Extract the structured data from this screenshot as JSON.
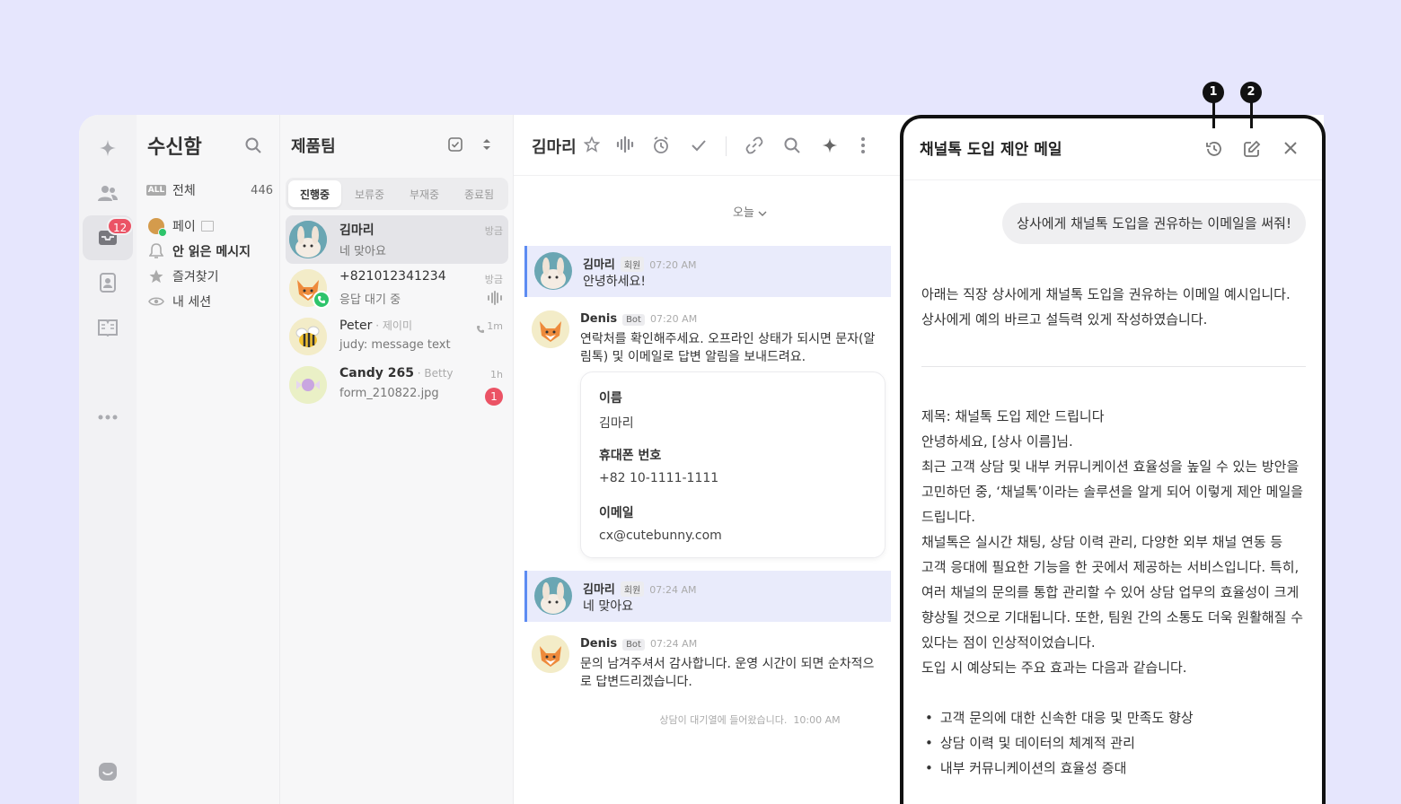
{
  "inbox": {
    "title": "수신함",
    "items": [
      {
        "label": "전체",
        "count": "446",
        "badge": "ALL"
      },
      {
        "label": "페이"
      },
      {
        "label": "안 읽은 메시지"
      },
      {
        "label": "즐겨찾기"
      },
      {
        "label": "내 세션"
      }
    ]
  },
  "rail": {
    "badge": "12",
    "ai_label": "AI"
  },
  "list": {
    "title": "제품팀",
    "tabs": [
      "진행중",
      "보류중",
      "부재중",
      "종료됨"
    ],
    "chats": [
      {
        "name": "김마리",
        "sub": "",
        "message": "네 맞아요",
        "time": "방금"
      },
      {
        "name": "+821012341234",
        "sub": "",
        "message": "응답 대기 중",
        "time": "방금"
      },
      {
        "name": "Peter",
        "sub": " · 제이미",
        "message": "judy: message text",
        "time": "1m"
      },
      {
        "name": "Candy 265",
        "sub": " · Betty",
        "message": "form_210822.jpg",
        "time": "1h",
        "unread": "1"
      }
    ]
  },
  "chat": {
    "name": "김마리",
    "date": "오늘",
    "messages": [
      {
        "name": "김마리",
        "tag": "회원",
        "time": "07:20 AM",
        "text": "안녕하세요!"
      },
      {
        "name": "Denis",
        "tag": "Bot",
        "time": "07:20 AM",
        "text": "연락처를 확인해주세요. 오프라인 상태가 되시면 문자(알림톡) 및 이메일로 답변 알림을 보내드려요."
      },
      {
        "name": "김마리",
        "tag": "회원",
        "time": "07:24 AM",
        "text": "네 맞아요"
      },
      {
        "name": "Denis",
        "tag": "Bot",
        "time": "07:24 AM",
        "text": "문의 남겨주셔서 감사합니다. 운영 시간이 되면 순차적으로 답변드리겠습니다."
      }
    ],
    "form": [
      {
        "label": "이름",
        "value": "김마리"
      },
      {
        "label": "휴대폰 번호",
        "value": "+82 10-1111-1111"
      },
      {
        "label": "이메일",
        "value": "cx@cutebunny.com"
      }
    ],
    "system_note": "상담이 대기열에 들어왔습니다.",
    "system_time": "10:00 AM"
  },
  "panel": {
    "title": "채널톡 도입 제안 메일",
    "prompt": "상사에게 채널톡 도입을 권유하는 이메일을 써줘!",
    "intro": "아래는 직장 상사에게 채널톡 도입을 권유하는 이메일 예시입니다. 상사에게 예의 바르고 설득력 있게 작성하였습니다.",
    "email_subject": "제목: 채널톡 도입 제안 드립니다",
    "email_greeting": "안녕하세요, [상사 이름]님.",
    "email_p1": "최근 고객 상담 및 내부 커뮤니케이션 효율성을 높일 수 있는 방안을 고민하던 중, ‘채널톡’이라는 솔루션을 알게 되어 이렇게 제안 메일을 드립니다.",
    "email_p2": "채널톡은 실시간 채팅, 상담 이력 관리, 다양한 외부 채널 연동 등 고객 응대에 필요한 기능을 한 곳에서 제공하는 서비스입니다. 특히, 여러 채널의 문의를 통합 관리할 수 있어 상담 업무의 효율성이 크게 향상될 것으로 기대됩니다. 또한, 팀원 간의 소통도 더욱 원활해질 수 있다는 점이 인상적이었습니다.",
    "email_p3": "도입 시 예상되는 주요 효과는 다음과 같습니다.",
    "bullets": [
      "고객 문의에 대한 신속한 대응 및 만족도 향상",
      "상담 이력 및 데이터의 체계적 관리",
      "내부 커뮤니케이션의 효율성 증대"
    ]
  },
  "callouts": [
    "1",
    "2"
  ],
  "colors": {
    "background": "#e6e6fd",
    "accent": "#5d8cf2",
    "badge": "#eb5365",
    "online": "#2ec46b"
  }
}
